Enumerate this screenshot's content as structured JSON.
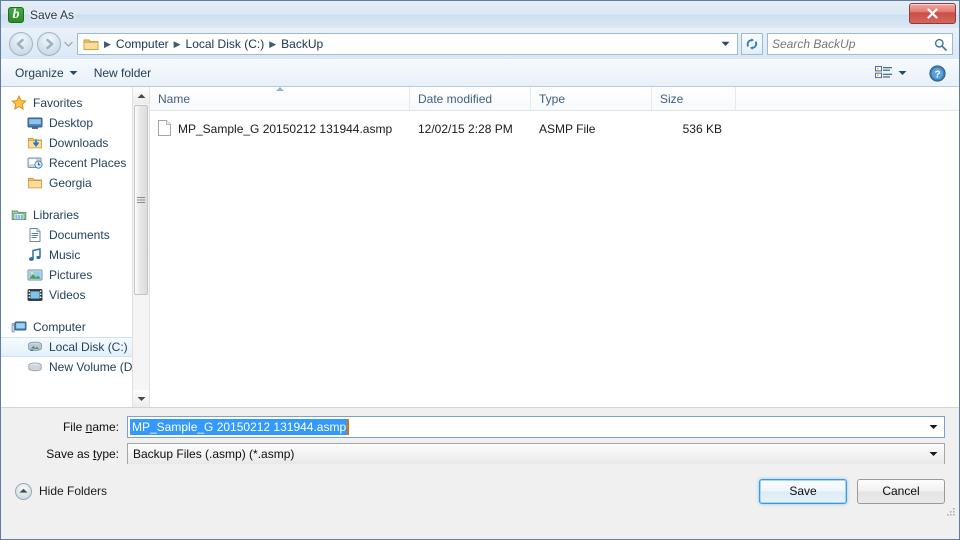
{
  "window": {
    "title": "Save As",
    "app_icon": "backup-app-icon",
    "close_label": "Close"
  },
  "navbar": {
    "back_icon": "back-arrow-icon",
    "forward_icon": "forward-arrow-icon",
    "history_icon": "chevron-down-icon",
    "folder_icon": "folder-icon",
    "breadcrumbs": [
      "Computer",
      "Local Disk (C:)",
      "BackUp"
    ],
    "dropdown_icon": "chevron-down-icon",
    "refresh_icon": "refresh-icon",
    "search": {
      "placeholder": "Search BackUp",
      "value": "",
      "icon": "search-icon"
    }
  },
  "toolbar": {
    "organize_label": "Organize",
    "organize_icon": "caret-down-icon",
    "new_folder_label": "New folder",
    "view_icon": "view-list-icon",
    "view_dropdown_icon": "caret-down-icon",
    "help_icon": "help-icon",
    "help_label": "?"
  },
  "sidebar": {
    "groups": [
      {
        "header": {
          "label": "Favorites",
          "icon": "star-icon"
        },
        "items": [
          {
            "label": "Desktop",
            "icon": "desktop-icon"
          },
          {
            "label": "Downloads",
            "icon": "downloads-folder-icon"
          },
          {
            "label": "Recent Places",
            "icon": "recent-places-icon"
          },
          {
            "label": "Georgia",
            "icon": "folder-icon"
          }
        ]
      },
      {
        "header": {
          "label": "Libraries",
          "icon": "libraries-icon"
        },
        "items": [
          {
            "label": "Documents",
            "icon": "documents-icon"
          },
          {
            "label": "Music",
            "icon": "music-icon"
          },
          {
            "label": "Pictures",
            "icon": "pictures-icon"
          },
          {
            "label": "Videos",
            "icon": "videos-icon"
          }
        ]
      },
      {
        "header": {
          "label": "Computer",
          "icon": "computer-icon"
        },
        "items": [
          {
            "label": "Local Disk (C:)",
            "icon": "hard-drive-icon",
            "selected": true
          },
          {
            "label": "New Volume (D:)",
            "icon": "drive-icon"
          }
        ]
      }
    ],
    "scrollbar": {
      "up_icon": "scroll-up-icon",
      "down_icon": "scroll-down-icon",
      "thumb_grip_icon": "grip-icon"
    }
  },
  "filelist": {
    "columns": [
      {
        "label": "Name",
        "sorted": true
      },
      {
        "label": "Date modified",
        "sorted": false
      },
      {
        "label": "Type",
        "sorted": false
      },
      {
        "label": "Size",
        "sorted": false
      }
    ],
    "rows": [
      {
        "icon": "file-icon",
        "name": "MP_Sample_G 20150212 131944.asmp",
        "date_modified": "12/02/15 2:28 PM",
        "type": "ASMP File",
        "size": "536 KB"
      }
    ]
  },
  "form": {
    "filename": {
      "label_prefix": "File ",
      "label_mnemonic": "n",
      "label_suffix": "ame:",
      "value": "MP_Sample_G 20150212 131944.asmp",
      "selected": true,
      "dropdown_icon": "caret-down-icon"
    },
    "savetype": {
      "label_prefix": "Save as ",
      "label_mnemonic": "t",
      "label_suffix": "ype:",
      "value": "Backup Files (.asmp) (*.asmp)",
      "dropdown_icon": "caret-down-icon"
    }
  },
  "footer": {
    "hide_folders_label": "Hide Folders",
    "hide_folders_icon": "collapse-up-icon",
    "save_label": "Save",
    "cancel_label": "Cancel",
    "resize_grip_icon": "resize-grip-icon"
  },
  "colors": {
    "accent": "#3399ff",
    "close_button": "#c94f46",
    "selection_blue": "#3399ff",
    "caret_orange": "#e07000",
    "titlebar_glass": "#cfe2f5"
  }
}
